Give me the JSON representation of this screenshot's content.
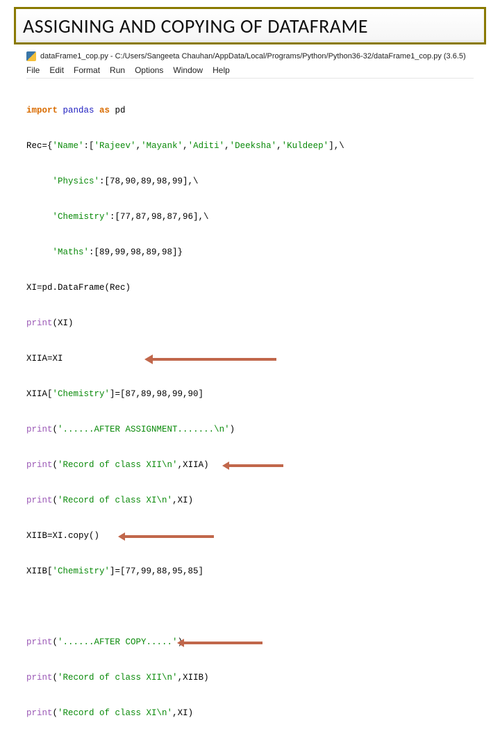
{
  "slide": {
    "title": "ASSIGNING AND COPYING OF DATAFRAME"
  },
  "window": {
    "icon": "python-idle-icon",
    "title": "dataFrame1_cop.py - C:/Users/Sangeeta Chauhan/AppData/Local/Programs/Python/Python36-32/dataFrame1_cop.py (3.6.5)"
  },
  "menu": {
    "file": "File",
    "edit": "Edit",
    "format": "Format",
    "run": "Run",
    "options": "Options",
    "window": "Window",
    "help": "Help"
  },
  "code": {
    "l1a": "import",
    "l1b": " pandas ",
    "l1c": "as",
    "l1d": " pd",
    "l2a": "Rec={",
    "l2b": "'Name'",
    "l2c": ":[",
    "l2d": "'Rajeev'",
    "l2e": ",",
    "l2f": "'Mayank'",
    "l2g": ",",
    "l2h": "'Aditi'",
    "l2i": ",",
    "l2j": "'Deeksha'",
    "l2k": ",",
    "l2l": "'Kuldeep'",
    "l2m": "],\\",
    "l3a": "     ",
    "l3b": "'Physics'",
    "l3c": ":[78,90,89,98,99],\\",
    "l4a": "     ",
    "l4b": "'Chemistry'",
    "l4c": ":[77,87,98,87,96],\\",
    "l5a": "     ",
    "l5b": "'Maths'",
    "l5c": ":[89,99,98,89,98]}",
    "l6": "XI=pd.DataFrame(Rec)",
    "l7a": "print",
    "l7b": "(XI)",
    "l8": "XIIA=XI",
    "l9a": "XIIA[",
    "l9b": "'Chemistry'",
    "l9c": "]=[87,89,98,99,90]",
    "l10a": "print",
    "l10b": "(",
    "l10c": "'......AFTER ASSIGNMENT.......\\n'",
    "l10d": ")",
    "l11a": "print",
    "l11b": "(",
    "l11c": "'Record of class XII\\n'",
    "l11d": ",XIIA)",
    "l12a": "print",
    "l12b": "(",
    "l12c": "'Record of class XI\\n'",
    "l12d": ",XI)",
    "l13": "XIIB=XI.copy()",
    "l14a": "XIIB[",
    "l14b": "'Chemistry'",
    "l14c": "]=[77,99,88,95,85]",
    "l16a": "print",
    "l16b": "(",
    "l16c": "'......AFTER COPY.....'",
    "l16d": ")",
    "l17a": "print",
    "l17b": "(",
    "l17c": "'Record of class XII\\n'",
    "l17d": ",XIIB)",
    "l18a": "print",
    "l18b": "(",
    "l18c": "'Record of class XI\\n'",
    "l18d": ",XI)"
  }
}
